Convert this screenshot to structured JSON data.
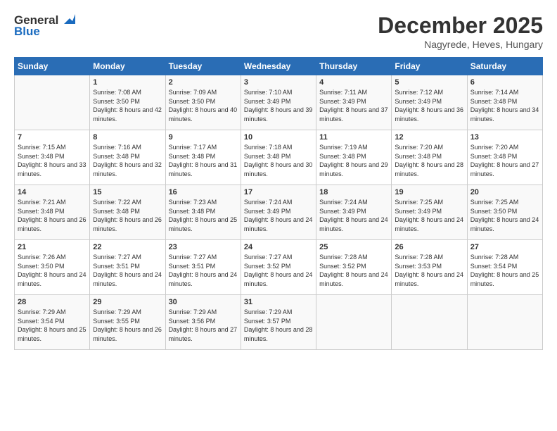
{
  "logo": {
    "line1": "General",
    "line2": "Blue"
  },
  "title": "December 2025",
  "location": "Nagyrede, Heves, Hungary",
  "days_header": [
    "Sunday",
    "Monday",
    "Tuesday",
    "Wednesday",
    "Thursday",
    "Friday",
    "Saturday"
  ],
  "weeks": [
    [
      {
        "day": "",
        "sunrise": "",
        "sunset": "",
        "daylight": ""
      },
      {
        "day": "1",
        "sunrise": "Sunrise: 7:08 AM",
        "sunset": "Sunset: 3:50 PM",
        "daylight": "Daylight: 8 hours and 42 minutes."
      },
      {
        "day": "2",
        "sunrise": "Sunrise: 7:09 AM",
        "sunset": "Sunset: 3:50 PM",
        "daylight": "Daylight: 8 hours and 40 minutes."
      },
      {
        "day": "3",
        "sunrise": "Sunrise: 7:10 AM",
        "sunset": "Sunset: 3:49 PM",
        "daylight": "Daylight: 8 hours and 39 minutes."
      },
      {
        "day": "4",
        "sunrise": "Sunrise: 7:11 AM",
        "sunset": "Sunset: 3:49 PM",
        "daylight": "Daylight: 8 hours and 37 minutes."
      },
      {
        "day": "5",
        "sunrise": "Sunrise: 7:12 AM",
        "sunset": "Sunset: 3:49 PM",
        "daylight": "Daylight: 8 hours and 36 minutes."
      },
      {
        "day": "6",
        "sunrise": "Sunrise: 7:14 AM",
        "sunset": "Sunset: 3:48 PM",
        "daylight": "Daylight: 8 hours and 34 minutes."
      }
    ],
    [
      {
        "day": "7",
        "sunrise": "Sunrise: 7:15 AM",
        "sunset": "Sunset: 3:48 PM",
        "daylight": "Daylight: 8 hours and 33 minutes."
      },
      {
        "day": "8",
        "sunrise": "Sunrise: 7:16 AM",
        "sunset": "Sunset: 3:48 PM",
        "daylight": "Daylight: 8 hours and 32 minutes."
      },
      {
        "day": "9",
        "sunrise": "Sunrise: 7:17 AM",
        "sunset": "Sunset: 3:48 PM",
        "daylight": "Daylight: 8 hours and 31 minutes."
      },
      {
        "day": "10",
        "sunrise": "Sunrise: 7:18 AM",
        "sunset": "Sunset: 3:48 PM",
        "daylight": "Daylight: 8 hours and 30 minutes."
      },
      {
        "day": "11",
        "sunrise": "Sunrise: 7:19 AM",
        "sunset": "Sunset: 3:48 PM",
        "daylight": "Daylight: 8 hours and 29 minutes."
      },
      {
        "day": "12",
        "sunrise": "Sunrise: 7:20 AM",
        "sunset": "Sunset: 3:48 PM",
        "daylight": "Daylight: 8 hours and 28 minutes."
      },
      {
        "day": "13",
        "sunrise": "Sunrise: 7:20 AM",
        "sunset": "Sunset: 3:48 PM",
        "daylight": "Daylight: 8 hours and 27 minutes."
      }
    ],
    [
      {
        "day": "14",
        "sunrise": "Sunrise: 7:21 AM",
        "sunset": "Sunset: 3:48 PM",
        "daylight": "Daylight: 8 hours and 26 minutes."
      },
      {
        "day": "15",
        "sunrise": "Sunrise: 7:22 AM",
        "sunset": "Sunset: 3:48 PM",
        "daylight": "Daylight: 8 hours and 26 minutes."
      },
      {
        "day": "16",
        "sunrise": "Sunrise: 7:23 AM",
        "sunset": "Sunset: 3:48 PM",
        "daylight": "Daylight: 8 hours and 25 minutes."
      },
      {
        "day": "17",
        "sunrise": "Sunrise: 7:24 AM",
        "sunset": "Sunset: 3:49 PM",
        "daylight": "Daylight: 8 hours and 24 minutes."
      },
      {
        "day": "18",
        "sunrise": "Sunrise: 7:24 AM",
        "sunset": "Sunset: 3:49 PM",
        "daylight": "Daylight: 8 hours and 24 minutes."
      },
      {
        "day": "19",
        "sunrise": "Sunrise: 7:25 AM",
        "sunset": "Sunset: 3:49 PM",
        "daylight": "Daylight: 8 hours and 24 minutes."
      },
      {
        "day": "20",
        "sunrise": "Sunrise: 7:25 AM",
        "sunset": "Sunset: 3:50 PM",
        "daylight": "Daylight: 8 hours and 24 minutes."
      }
    ],
    [
      {
        "day": "21",
        "sunrise": "Sunrise: 7:26 AM",
        "sunset": "Sunset: 3:50 PM",
        "daylight": "Daylight: 8 hours and 24 minutes."
      },
      {
        "day": "22",
        "sunrise": "Sunrise: 7:27 AM",
        "sunset": "Sunset: 3:51 PM",
        "daylight": "Daylight: 8 hours and 24 minutes."
      },
      {
        "day": "23",
        "sunrise": "Sunrise: 7:27 AM",
        "sunset": "Sunset: 3:51 PM",
        "daylight": "Daylight: 8 hours and 24 minutes."
      },
      {
        "day": "24",
        "sunrise": "Sunrise: 7:27 AM",
        "sunset": "Sunset: 3:52 PM",
        "daylight": "Daylight: 8 hours and 24 minutes."
      },
      {
        "day": "25",
        "sunrise": "Sunrise: 7:28 AM",
        "sunset": "Sunset: 3:52 PM",
        "daylight": "Daylight: 8 hours and 24 minutes."
      },
      {
        "day": "26",
        "sunrise": "Sunrise: 7:28 AM",
        "sunset": "Sunset: 3:53 PM",
        "daylight": "Daylight: 8 hours and 24 minutes."
      },
      {
        "day": "27",
        "sunrise": "Sunrise: 7:28 AM",
        "sunset": "Sunset: 3:54 PM",
        "daylight": "Daylight: 8 hours and 25 minutes."
      }
    ],
    [
      {
        "day": "28",
        "sunrise": "Sunrise: 7:29 AM",
        "sunset": "Sunset: 3:54 PM",
        "daylight": "Daylight: 8 hours and 25 minutes."
      },
      {
        "day": "29",
        "sunrise": "Sunrise: 7:29 AM",
        "sunset": "Sunset: 3:55 PM",
        "daylight": "Daylight: 8 hours and 26 minutes."
      },
      {
        "day": "30",
        "sunrise": "Sunrise: 7:29 AM",
        "sunset": "Sunset: 3:56 PM",
        "daylight": "Daylight: 8 hours and 27 minutes."
      },
      {
        "day": "31",
        "sunrise": "Sunrise: 7:29 AM",
        "sunset": "Sunset: 3:57 PM",
        "daylight": "Daylight: 8 hours and 28 minutes."
      },
      {
        "day": "",
        "sunrise": "",
        "sunset": "",
        "daylight": ""
      },
      {
        "day": "",
        "sunrise": "",
        "sunset": "",
        "daylight": ""
      },
      {
        "day": "",
        "sunrise": "",
        "sunset": "",
        "daylight": ""
      }
    ]
  ]
}
